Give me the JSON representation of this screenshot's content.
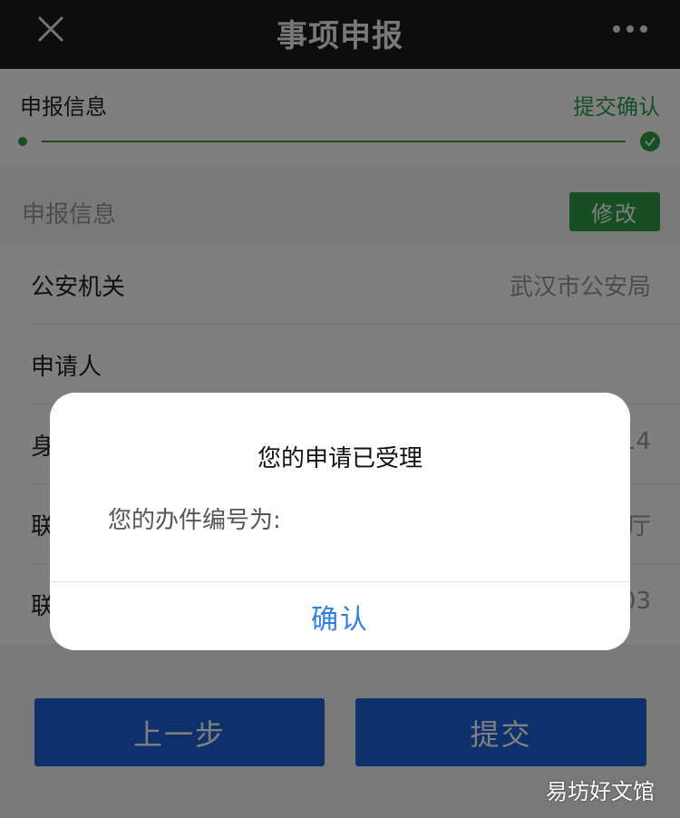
{
  "navbar": {
    "title": "事项申报",
    "close_icon": "close-icon",
    "more_icon": "more-dots-icon"
  },
  "steps": {
    "left_label": "申报信息",
    "right_label": "提交确认",
    "active_color": "#2f9e44"
  },
  "section": {
    "title": "申报信息",
    "modify_label": "修改"
  },
  "form": {
    "rows": [
      {
        "label": "公安机关",
        "value": "武汉市公安局"
      },
      {
        "label": "申请人",
        "value": ""
      },
      {
        "label": "身",
        "value": "14"
      },
      {
        "label": "联",
        "value": "厅"
      },
      {
        "label": "联",
        "value": "03"
      }
    ]
  },
  "bottom": {
    "prev_label": "上一步",
    "submit_label": "提交",
    "button_color": "#1c63d8"
  },
  "dialog": {
    "title": "您的申请已受理",
    "message": "您的办件编号为:",
    "confirm_label": "确认",
    "confirm_color": "#2f7fe0"
  },
  "watermark": {
    "text": "易坊好文馆"
  }
}
